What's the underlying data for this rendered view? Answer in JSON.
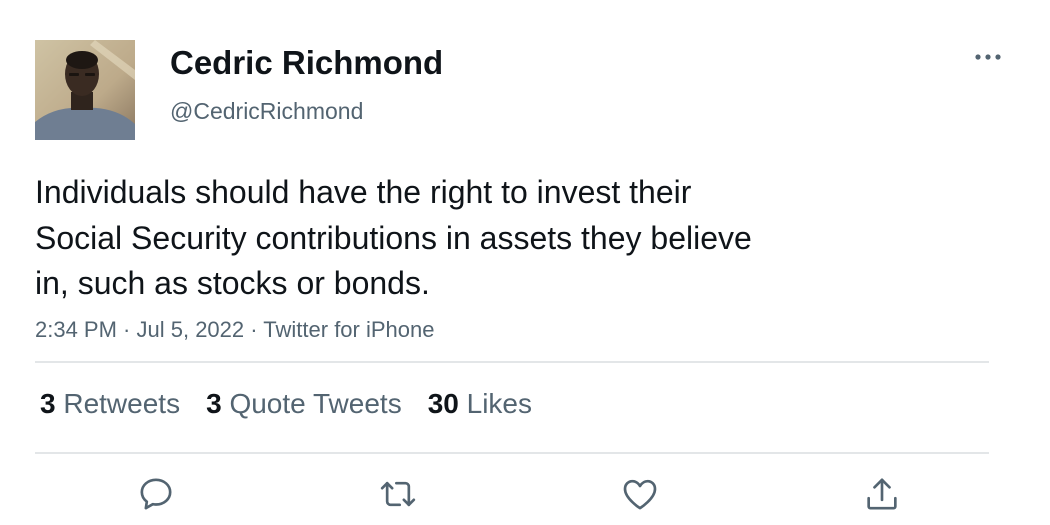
{
  "author": {
    "display_name": "Cedric Richmond",
    "handle": "@CedricRichmond",
    "avatar": "profile-photo"
  },
  "tweet": {
    "text_lines": [
      "Individuals should have the right to invest their",
      "Social Security contributions in assets they believe",
      "in, such as stocks or bonds."
    ],
    "time": "2:34 PM",
    "separator1": " · ",
    "date": "Jul 5, 2022",
    "separator2": " · ",
    "source": "Twitter for iPhone"
  },
  "stats": {
    "retweets": {
      "count": "3",
      "label": "Retweets"
    },
    "quote_tweets": {
      "count": "3",
      "label": "Quote Tweets"
    },
    "likes": {
      "count": "30",
      "label": "Likes"
    }
  },
  "actions": {
    "reply": "reply-icon",
    "retweet": "retweet-icon",
    "like": "heart-icon",
    "share": "share-icon"
  },
  "colors": {
    "text": "#0f1419",
    "secondary": "#536471",
    "divider": "#e3e6e8"
  }
}
